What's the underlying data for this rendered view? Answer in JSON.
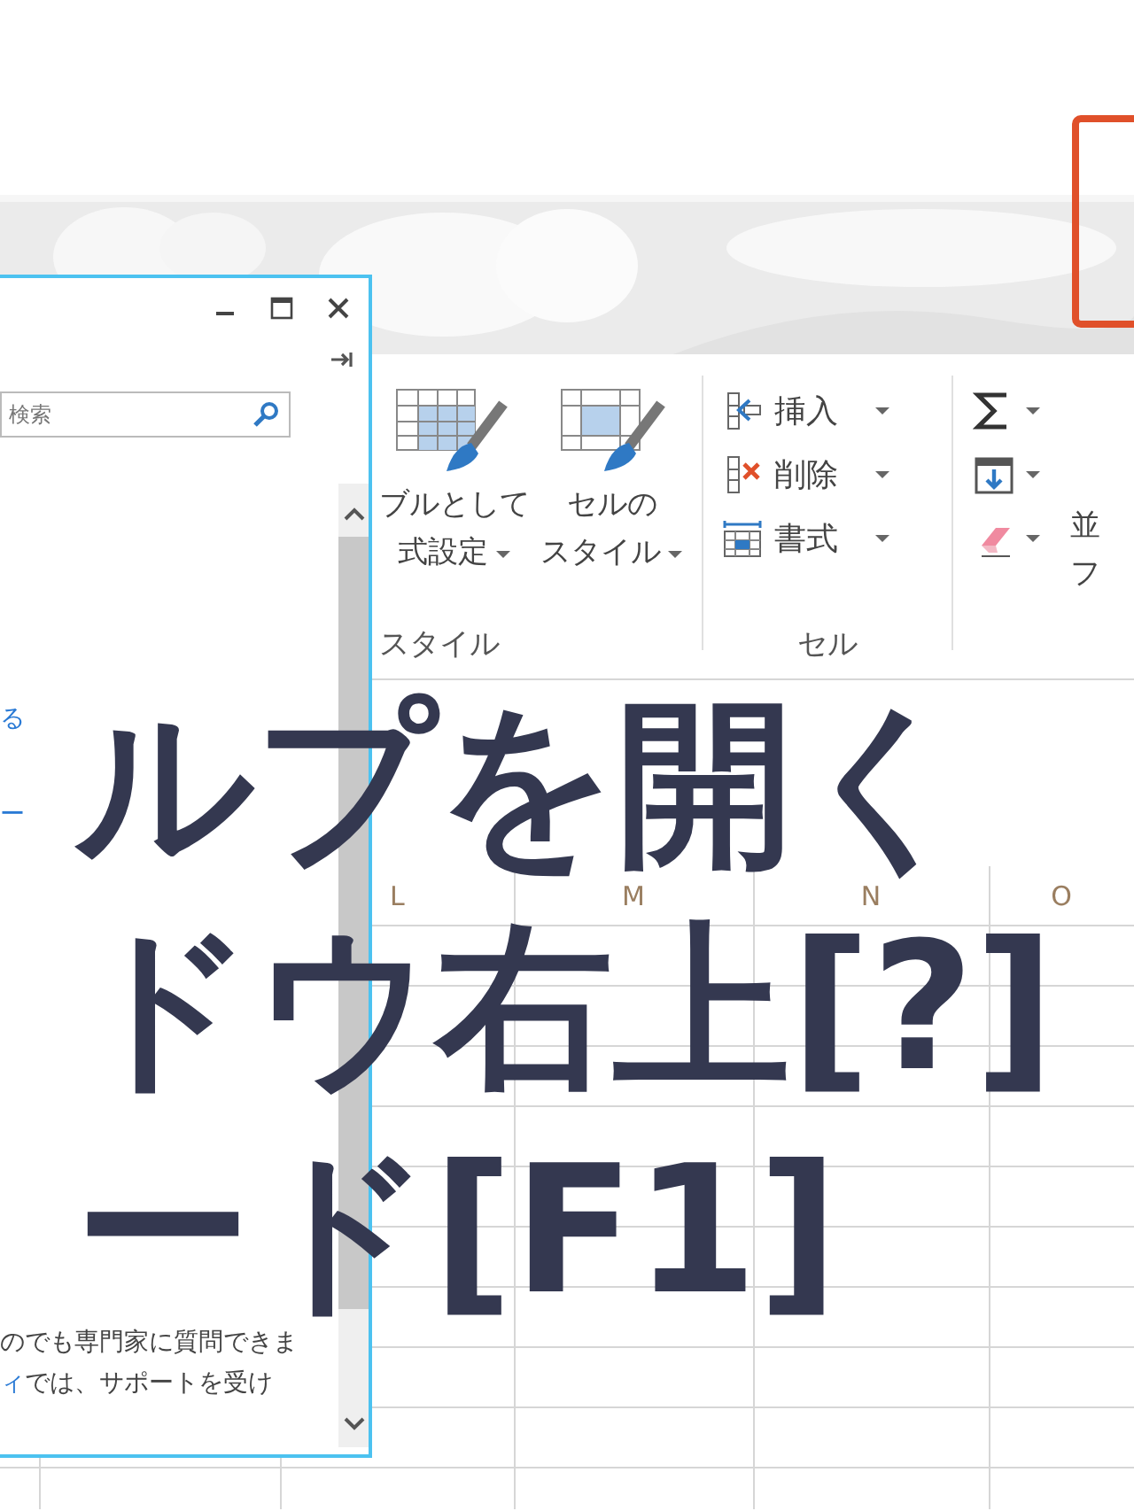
{
  "help_window": {
    "search": {
      "placeholder": "検索"
    },
    "links": [
      "る",
      "ー"
    ],
    "body": {
      "line_1": "のでも専門家に質問できま",
      "link": "ィ",
      "line_2": "では、サポートを受け"
    }
  },
  "ribbon": {
    "styles_group": {
      "label": "スタイル",
      "buttons": [
        {
          "kind": "table",
          "lines": [
            "ブルとして",
            "式設定"
          ]
        },
        {
          "kind": "cell",
          "lines": [
            "セルの",
            "スタイル"
          ]
        }
      ]
    },
    "cells_group": {
      "label": "セル",
      "commands": [
        {
          "kind": "insert",
          "label": "挿入"
        },
        {
          "kind": "delete",
          "label": "削除"
        },
        {
          "kind": "format",
          "label": "書式"
        }
      ]
    },
    "editing_group": {
      "tools": [
        {
          "kind": "sum"
        },
        {
          "kind": "fill"
        },
        {
          "kind": "clear"
        }
      ],
      "cut_label_lines": [
        "並",
        "フ"
      ]
    }
  },
  "sheet": {
    "column_headers": [
      "L",
      "M",
      "N",
      "O"
    ]
  },
  "title_overlay": {
    "lines": [
      "ルプを開く",
      "ドウ右上[?]",
      "ード[F1]"
    ]
  }
}
